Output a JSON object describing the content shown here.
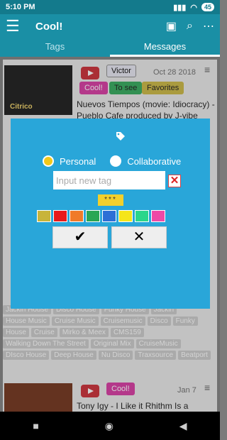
{
  "status": {
    "time": "5:10 PM",
    "battery": "45"
  },
  "appbar": {
    "title": "Cool!"
  },
  "tabs": [
    {
      "label": "Tags"
    },
    {
      "label": "Messages"
    }
  ],
  "cards": [
    {
      "thumb_text": "Citrico",
      "chips": [
        "Victor",
        "Cool!",
        "To see",
        "Favorites"
      ],
      "date": "Oct 28 2018",
      "title": "Nuevos Tiempos (movie: Idiocracy) - Pueblo Cafe produced by J-vibe"
    },
    {
      "tags": [
        "Jackin House",
        "Disco House",
        "Funky House",
        "Jackin",
        "House Music",
        "Cruise Music",
        "Cruisemusic",
        "Disco",
        "Funky",
        "House",
        "Cruise",
        "Mirko & Meex",
        "CMS159",
        "Walking Down The Street",
        "Original Mix",
        "CruiseMusic",
        "DIsco House",
        "Deep House",
        "Nu Disco",
        "Traxsource",
        "Beatport"
      ]
    },
    {
      "chips": [
        "Cool!"
      ],
      "date": "Jan 7",
      "title": "Tony Igy - I Like it Rhithm Is a"
    }
  ],
  "dialog": {
    "radio_personal": "Personal",
    "radio_collaborative": "Collaborative",
    "input_placeholder": "Input new tag",
    "stars": "***",
    "swatch_colors": [
      "#c8b43a",
      "#e81b1b",
      "#f07a2a",
      "#2aa654",
      "#2d6fd6",
      "#f5e51a",
      "#2ad68a",
      "#ee4aa6"
    ],
    "accent": "#29a6d9"
  }
}
